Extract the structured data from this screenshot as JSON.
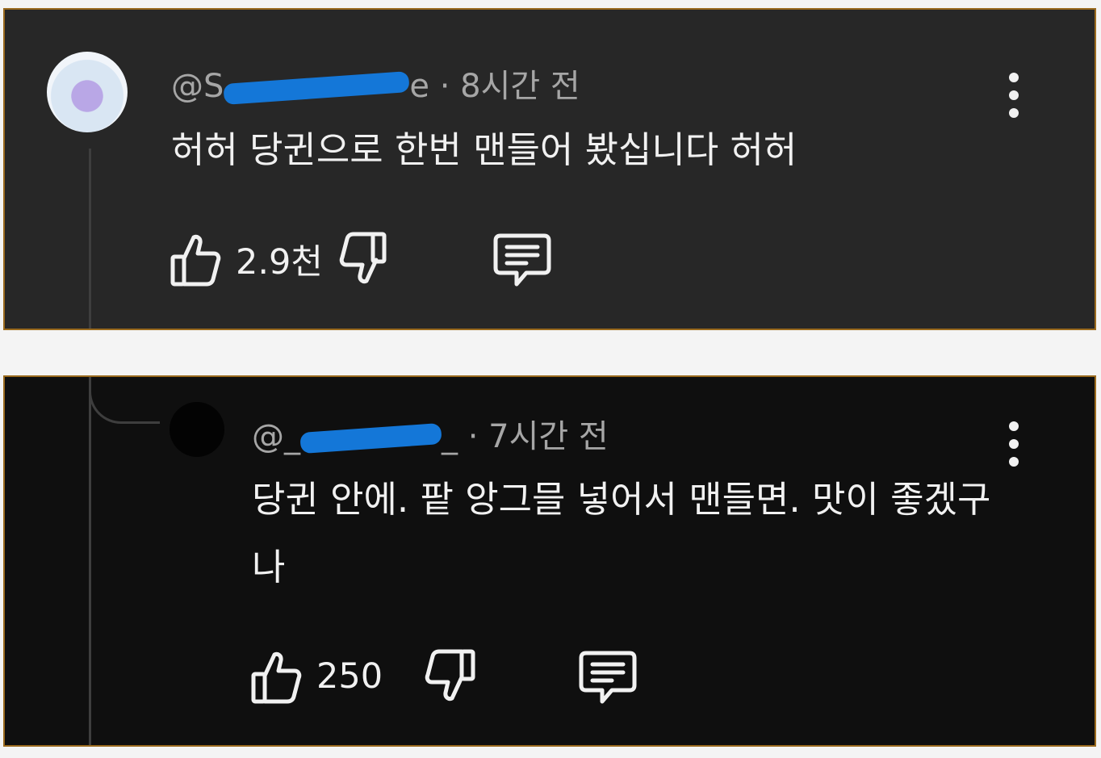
{
  "comments": [
    {
      "author": "@S",
      "author_suffix": "e",
      "separator": "·",
      "time": "8시간 전",
      "text": "허허 당귄으로 한번 맨들어 봤십니다 허허",
      "likes": "2.9천",
      "avatar": "octopus-avatar"
    },
    {
      "author": "@_",
      "author_suffix": "_",
      "separator": "·",
      "time": "7시간 전",
      "text": "당귄 안에. 팥 앙그믈 넣어서 맨들면. 맛이 좋겠구나",
      "likes": "250",
      "avatar": "black-avatar"
    }
  ],
  "icons": {
    "like": "thumbs-up-icon",
    "dislike": "thumbs-down-icon",
    "reply": "comment-bubble-icon",
    "menu": "vertical-ellipsis-icon"
  },
  "colors": {
    "redaction": "#1477d8",
    "panel1_bg": "#272727",
    "panel2_bg": "#0f0f0f",
    "border": "#9a6a1e"
  }
}
